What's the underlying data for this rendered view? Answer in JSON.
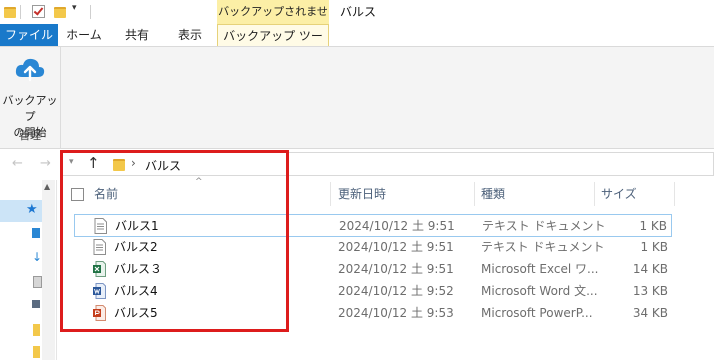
{
  "window": {
    "backup_context_label": "バックアップされません",
    "title": "バルス"
  },
  "ribbon": {
    "tabs": [
      "ファイル",
      "ホーム",
      "共有",
      "表示",
      "バックアップ ツール"
    ],
    "backup_start_label_1": "バックアップ",
    "backup_start_label_2": "の開始",
    "group_label": "管理"
  },
  "address": {
    "breadcrumb_sep": "›",
    "path": "バルス"
  },
  "columns": {
    "name": "名前",
    "date": "更新日時",
    "type": "種類",
    "size": "サイズ"
  },
  "files": [
    {
      "name": "バルス1",
      "date": "2024/10/12 土 9:51",
      "type": "テキスト ドキュメント",
      "size": "1 KB",
      "icon": "text-file-icon"
    },
    {
      "name": "バルス2",
      "date": "2024/10/12 土 9:51",
      "type": "テキスト ドキュメント",
      "size": "1 KB",
      "icon": "text-file-icon"
    },
    {
      "name": "バルス３",
      "date": "2024/10/12 土 9:51",
      "type": "Microsoft Excel ワ...",
      "size": "14 KB",
      "icon": "excel-file-icon"
    },
    {
      "name": "バルス4",
      "date": "2024/10/12 土 9:52",
      "type": "Microsoft Word 文...",
      "size": "13 KB",
      "icon": "word-file-icon"
    },
    {
      "name": "バルス5",
      "date": "2024/10/12 土 9:53",
      "type": "Microsoft PowerP...",
      "size": "34 KB",
      "icon": "powerpoint-file-icon"
    }
  ],
  "colors": {
    "file_tab": "#1979ca",
    "context_tab": "#fcefa6",
    "highlight_box": "#dd1c1c",
    "selection": "#cce4f7"
  }
}
